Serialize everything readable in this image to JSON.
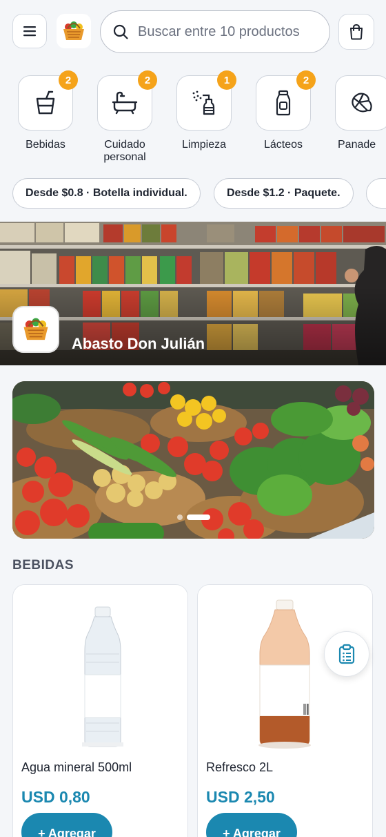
{
  "header": {
    "search_placeholder": "Buscar entre 10 productos"
  },
  "categories": [
    {
      "label": "Bebidas",
      "count": "2",
      "icon": "cup-icon"
    },
    {
      "label": "Cuidado personal",
      "count": "2",
      "icon": "bathtub-icon"
    },
    {
      "label": "Limpieza",
      "count": "1",
      "icon": "spray-bottle-icon"
    },
    {
      "label": "Lácteos",
      "count": "2",
      "icon": "milk-bottle-icon"
    },
    {
      "label": "Panade",
      "icon": "croissant-icon"
    }
  ],
  "price_chips": [
    {
      "label": "Desde $0.8 · Botella individual."
    },
    {
      "label": "Desde $1.2 · Paquete."
    }
  ],
  "store": {
    "name": "Abasto Don Julián"
  },
  "carousel": {
    "slide_count": 2,
    "active_index": 1
  },
  "section": {
    "title": "BEBIDAS"
  },
  "products": [
    {
      "name": "Agua mineral 500ml",
      "price": "USD 0,80",
      "add_label": "+ Agregar"
    },
    {
      "name": "Refresco 2L",
      "price": "USD 2,50",
      "add_label": "+ Agregar"
    }
  ],
  "colors": {
    "accent": "#1b88b0",
    "badge": "#f5a31a",
    "background": "#f4f6f9"
  }
}
